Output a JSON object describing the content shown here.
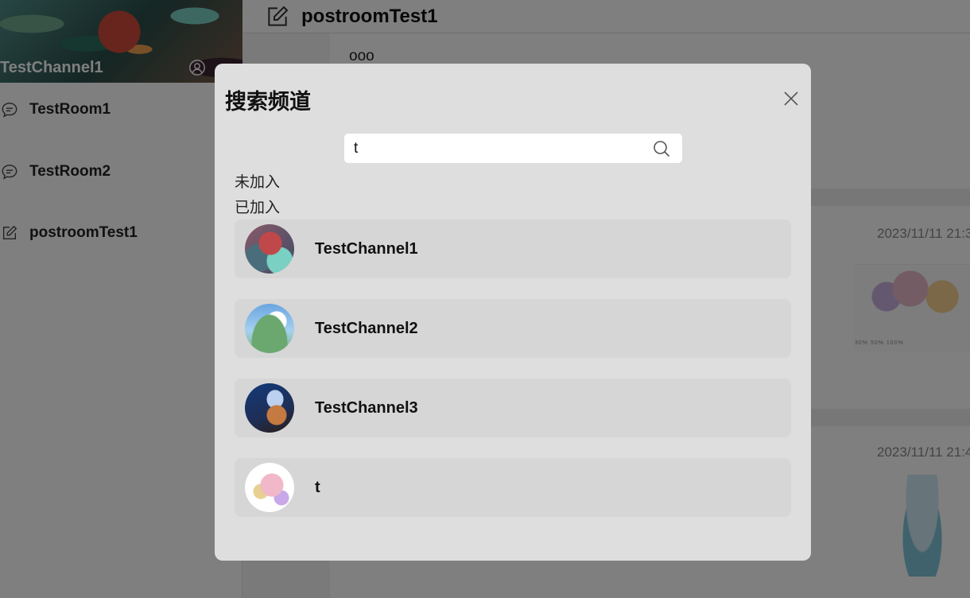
{
  "sidebar": {
    "channel_name": "TestChannel1",
    "rooms": [
      {
        "label": "TestRoom1",
        "icon": "chat-bubble-icon"
      },
      {
        "label": "TestRoom2",
        "icon": "chat-bubble-icon"
      },
      {
        "label": "postroomTest1",
        "icon": "edit-icon"
      }
    ]
  },
  "main": {
    "header_title": "postroomTest1",
    "post_text": "ooo",
    "posts": [
      {
        "time": "2023/11/11 21:3"
      },
      {
        "time": "2023/11/11 21:4"
      }
    ],
    "thumb_toolbar": "30%  50%  100%"
  },
  "dialog": {
    "title": "搜索频道",
    "search_value": "t",
    "sections": {
      "not_joined": "未加入",
      "joined": "已加入"
    },
    "results": [
      {
        "name": "TestChannel1"
      },
      {
        "name": "TestChannel2"
      },
      {
        "name": "TestChannel3"
      },
      {
        "name": "t"
      }
    ]
  },
  "colors": {
    "overlay": "#000000",
    "dialog_bg": "#dedede",
    "card_bg": "#d6d6d6"
  }
}
